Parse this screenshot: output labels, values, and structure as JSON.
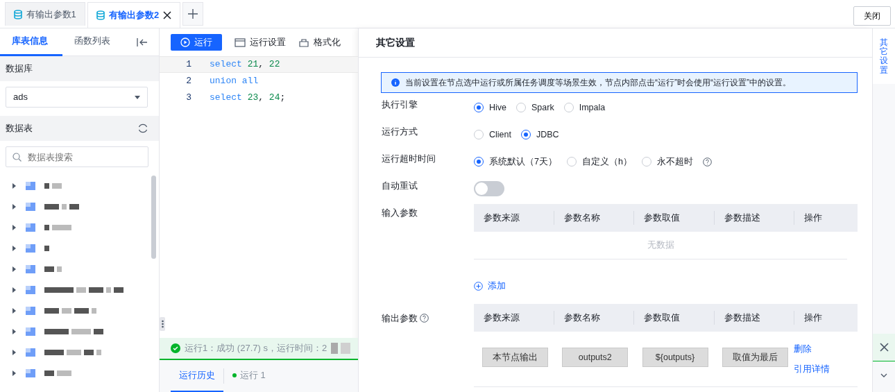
{
  "tabs": [
    {
      "label": "有输出参数1",
      "selected": false,
      "closable": false
    },
    {
      "label": "有输出参数2",
      "selected": true,
      "closable": true
    }
  ],
  "close_button": "关闭",
  "sidebar": {
    "tabs": [
      {
        "label": "库表信息",
        "selected": true
      },
      {
        "label": "函数列表",
        "selected": false
      }
    ],
    "database_label": "数据库",
    "database_value": "ads",
    "tables_label": "数据表",
    "search": {
      "placeholder": "数据表搜索"
    },
    "tables": [
      {
        "expanded": false
      },
      {
        "expanded": false
      },
      {
        "expanded": false
      },
      {
        "expanded": false
      },
      {
        "expanded": false
      },
      {
        "expanded": false
      },
      {
        "expanded": false
      },
      {
        "expanded": false
      },
      {
        "expanded": false
      },
      {
        "expanded": false
      }
    ]
  },
  "toolbar": {
    "run": "运行",
    "buttons": [
      {
        "label": "运行设置"
      },
      {
        "label": "格式化"
      }
    ]
  },
  "editor": {
    "lines": [
      {
        "number": "1",
        "current": true,
        "tokens": [
          {
            "kind": "keyword",
            "text": "select"
          },
          {
            "kind": "number",
            "text": "21"
          },
          {
            "kind": "punct",
            "text": ","
          },
          {
            "kind": "number",
            "text": "22"
          }
        ]
      },
      {
        "number": "2",
        "current": false,
        "tokens": [
          {
            "kind": "keyword",
            "text": "union"
          },
          {
            "kind": "keyword",
            "text": "all"
          }
        ]
      },
      {
        "number": "3",
        "current": false,
        "tokens": [
          {
            "kind": "keyword",
            "text": "select"
          },
          {
            "kind": "number",
            "text": "23"
          },
          {
            "kind": "punct",
            "text": ","
          },
          {
            "kind": "number",
            "text": "24"
          },
          {
            "kind": "punct",
            "text": ";"
          }
        ]
      }
    ]
  },
  "status": {
    "kind": "success",
    "text": "运行1：成功 (27.7) s，运行时间：2"
  },
  "bottom_tabs": [
    {
      "label": "运行历史",
      "selected": true
    },
    {
      "label": "运行 1",
      "selected": false,
      "color": "#00b42a"
    }
  ],
  "drawer": {
    "title": "其它设置",
    "notice": "当前设置在节点选中运行或所属任务调度等场景生效，节点内部点击“运行”时会使用“运行设置”中的设置。",
    "rows": [
      {
        "kind": "radio",
        "label": "执行引擎",
        "help": false,
        "options": [
          {
            "label": "Hive",
            "selected": true
          },
          {
            "label": "Spark",
            "selected": false
          },
          {
            "label": "Impala",
            "selected": false
          }
        ]
      },
      {
        "kind": "radio",
        "label": "运行方式",
        "help": false,
        "options": [
          {
            "label": "Client",
            "selected": false
          },
          {
            "label": "JDBC",
            "selected": true
          }
        ]
      },
      {
        "kind": "radio",
        "label": "运行超时时间",
        "help": true,
        "options": [
          {
            "label": "系统默认（7天）",
            "selected": true
          },
          {
            "label": "自定义（h）",
            "selected": false
          },
          {
            "label": "永不超时",
            "selected": false
          }
        ]
      },
      {
        "kind": "switch",
        "label": "自动重试",
        "on": false
      }
    ],
    "input_params": {
      "label": "输入参数",
      "columns": [
        "参数来源",
        "参数名称",
        "参数取值",
        "参数描述",
        "操作"
      ],
      "empty": "无数据",
      "add": "添加"
    },
    "output_params": {
      "label": "输出参数",
      "help": true,
      "columns": [
        "参数来源",
        "参数名称",
        "参数取值",
        "参数描述",
        "操作"
      ],
      "rows": [
        {
          "cells": [
            "本节点输出",
            "outputs2",
            "${outputs}",
            "取值为最后"
          ],
          "actions": [
            "删除",
            "引用详情"
          ]
        }
      ]
    }
  },
  "side_rail": {
    "label": "其它设置",
    "selected": true
  }
}
